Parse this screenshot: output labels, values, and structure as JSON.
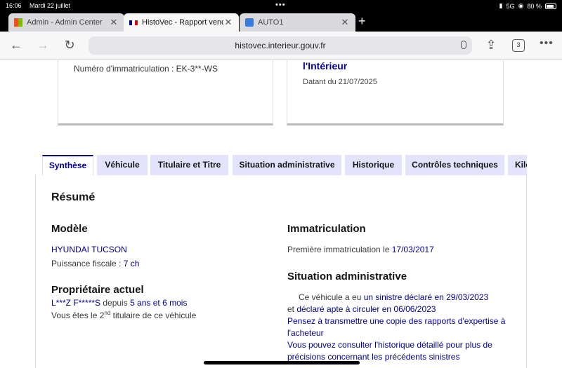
{
  "status_bar": {
    "time": "16:06",
    "date": "Mardi 22 juillet",
    "signal": "5G",
    "battery": "80 %"
  },
  "browser": {
    "tabs": [
      {
        "title": "Admin - Admin Center",
        "active": false,
        "icon": "office-icon"
      },
      {
        "title": "HistoVec - Rapport vendeur",
        "active": true,
        "icon": "french-flag-icon"
      },
      {
        "title": "AUTO1",
        "active": false,
        "icon": "auto1-icon"
      }
    ],
    "new_tab_label": "+",
    "url": "histovec.interieur.gouv.fr",
    "tab_count": "3"
  },
  "cards": {
    "registration_text": "Numéro d'immatriculation : EK-3**-WS",
    "ministry_title": "l'Intérieur",
    "ministry_date": "Datant du 21/07/2025"
  },
  "report_tabs": [
    "Synthèse",
    "Véhicule",
    "Titulaire et Titre",
    "Situation administrative",
    "Historique",
    "Contrôles techniques",
    "Kilométrage"
  ],
  "summary": {
    "title": "Résumé",
    "model_title": "Modèle",
    "model_name": "HYUNDAI TUCSON",
    "fiscal_power_label": "Puissance fiscale : ",
    "fiscal_power_value": "7 ch",
    "owner_title": "Propriétaire actuel",
    "owner_name": "L***Z F*****S",
    "owner_since_prefix": " depuis ",
    "owner_since_value": "5 ans et 6 mois",
    "holder_prefix": "Vous êtes le 2",
    "holder_sup": "nd",
    "holder_suffix": " titulaire de ce véhicule",
    "registration_title": "Immatriculation",
    "first_registration_label": "Première immatriculation le ",
    "first_registration_date": "17/03/2017",
    "admin_title": "Situation administrative",
    "admin_line1_prefix": "Ce véhicule a eu ",
    "admin_line1_link": "un sinistre déclaré en 29/03/2023",
    "admin_line2_prefix": "et ",
    "admin_line2_link": "déclaré apte à circuler en 06/06/2023",
    "admin_line3": "Pensez à transmettre une copie des rapports d'expertise à",
    "admin_line4": "l'acheteur",
    "admin_line5": "Vous pouvez consulter l'historique détaillé pour plus de",
    "admin_line6": "précisions concernant les précédents sinistres"
  }
}
